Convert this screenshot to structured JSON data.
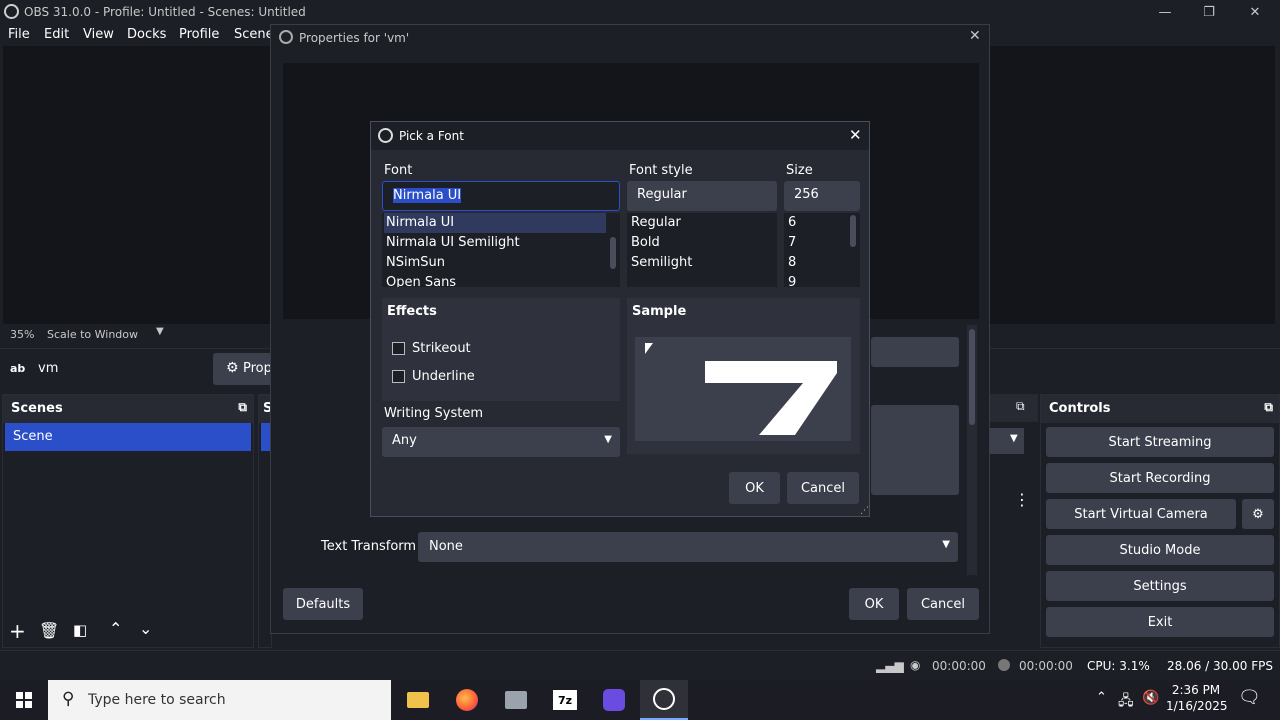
{
  "window": {
    "title": "OBS 31.0.0 - Profile: Untitled - Scenes: Untitled",
    "minimize": "—",
    "maximize": "❐",
    "close": "✕"
  },
  "menu": [
    "File",
    "Edit",
    "View",
    "Docks",
    "Profile",
    "Scene"
  ],
  "zoom": {
    "percent": "35%",
    "mode": "Scale to Window"
  },
  "source_bar": {
    "source_icon": "ab",
    "source_name": "vm",
    "properties_label": "Prop"
  },
  "scenes": {
    "title": "Scenes",
    "items": [
      "Scene"
    ]
  },
  "sources_panel": {
    "title": "S"
  },
  "controls": {
    "title": "Controls",
    "buttons": [
      "Start Streaming",
      "Start Recording",
      "Start Virtual Camera",
      "Studio Mode",
      "Settings",
      "Exit"
    ]
  },
  "properties": {
    "title": "Properties for 'vm'",
    "text_transform_label": "Text Transform",
    "text_transform_value": "None",
    "defaults": "Defaults",
    "ok": "OK",
    "cancel": "Cancel"
  },
  "font_dialog": {
    "title": "Pick a Font",
    "font_label": "Font",
    "font_value": "Nirmala UI",
    "fonts": [
      "Nirmala UI",
      "Nirmala UI Semilight",
      "NSimSun",
      "Open Sans"
    ],
    "style_label": "Font style",
    "style_value": "Regular",
    "styles": [
      "Regular",
      "Bold",
      "Semilight"
    ],
    "size_label": "Size",
    "size_value": "256",
    "sizes": [
      "6",
      "7",
      "8",
      "9"
    ],
    "effects_label": "Effects",
    "strikeout": "Strikeout",
    "underline": "Underline",
    "sample_label": "Sample",
    "writing_system_label": "Writing System",
    "writing_system_value": "Any",
    "ok": "OK",
    "cancel": "Cancel"
  },
  "status": {
    "stream_time": "00:00:00",
    "rec_time": "00:00:00",
    "cpu": "CPU: 3.1%",
    "fps": "28.06 / 30.00 FPS"
  },
  "taskbar": {
    "search_placeholder": "Type here to search",
    "time": "2:36 PM",
    "date": "1/16/2025"
  },
  "colors": {
    "accent": "#2a4fc8",
    "panel": "#272a33",
    "button": "#3c404d"
  }
}
